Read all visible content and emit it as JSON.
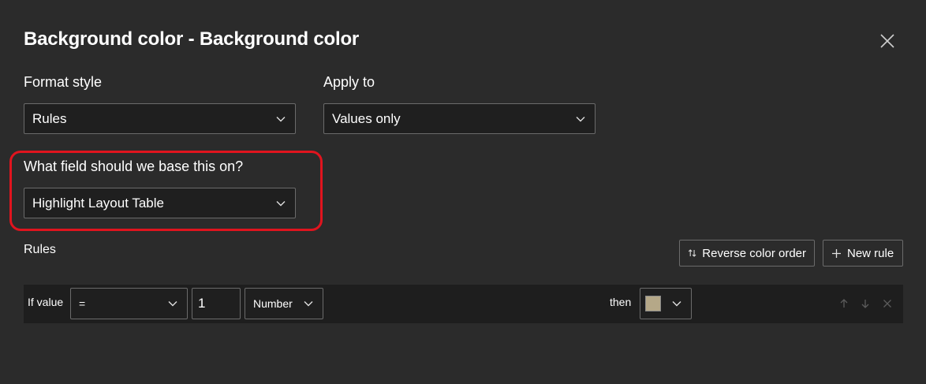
{
  "dialog": {
    "title": "Background color - Background color"
  },
  "format_style": {
    "label": "Format style",
    "value": "Rules"
  },
  "apply_to": {
    "label": "Apply to",
    "value": "Values only"
  },
  "base_field": {
    "label": "What field should we base this on?",
    "value": "Highlight Layout Table"
  },
  "rules": {
    "label": "Rules",
    "reverse_label": "Reverse color order",
    "new_rule_label": "New rule"
  },
  "rule_row": {
    "if_value_label": "If value",
    "operator": "=",
    "value": "1",
    "type": "Number",
    "then_label": "then",
    "color": "#b5a888"
  },
  "colors": {
    "background": "#2b2b2b",
    "highlight_ring": "#e0141e"
  }
}
